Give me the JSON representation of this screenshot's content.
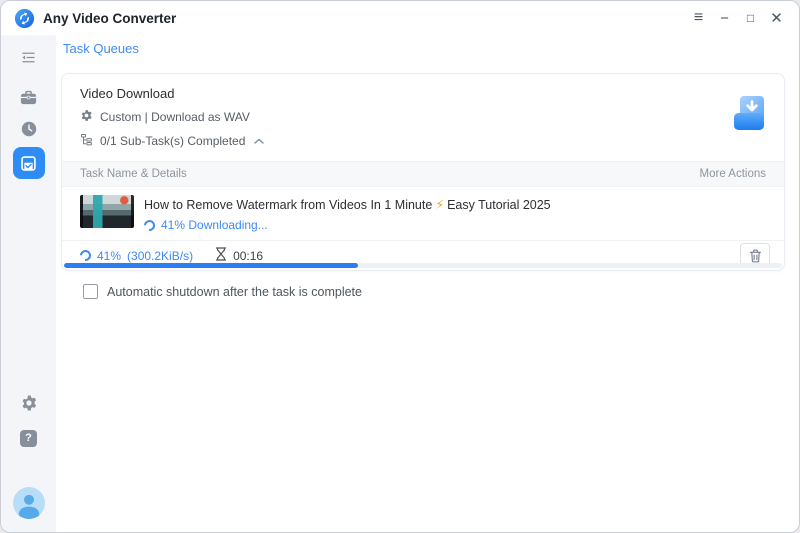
{
  "app": {
    "name": "Any Video Converter"
  },
  "window_controls": {
    "menu": "≡",
    "minimize": "−",
    "maximize": "□",
    "close": "✕"
  },
  "nav": {
    "page_title": "Task Queues"
  },
  "queue_card": {
    "title": "Video Download",
    "profile_info": "Custom | Download as WAV",
    "subtask_summary": "0/1 Sub-Task(s) Completed",
    "columns": {
      "task": "Task Name & Details",
      "actions": "More Actions"
    },
    "task": {
      "title_main": "How to Remove Watermark from Videos In 1 Minute",
      "title_bolt": "⚡",
      "title_tail": "Easy Tutorial 2025",
      "inline_status": "41% Downloading...",
      "percent": "41%",
      "speed": "(300.2KiB/s)",
      "elapsed": "00:16",
      "progress_style": "width:41%"
    }
  },
  "options": {
    "shutdown_label": "Automatic shutdown after the task is complete",
    "shutdown_checked": false
  },
  "icons": {
    "help": "?"
  },
  "colors": {
    "accent_blue": "#2E86F0",
    "progress_blue": "#2B7FF2",
    "status_text_blue": "#3D8AF5",
    "bolt_orange": "#F5A623",
    "sidebar_bg": "#F3F5F8",
    "active_icon_bg": "#2F8CF5"
  }
}
